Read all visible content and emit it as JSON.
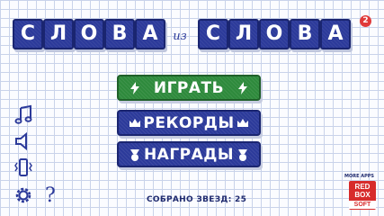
{
  "title": {
    "left_word": [
      "С",
      "Л",
      "О",
      "В",
      "А"
    ],
    "connector": "из",
    "right_word": [
      "С",
      "Л",
      "О",
      "В",
      "А"
    ],
    "version_badge": "2"
  },
  "menu": {
    "play_label": "ИГРАТЬ",
    "records_label": "РЕКОРДЫ",
    "awards_label": "НАГРАДЫ"
  },
  "footer": {
    "stars_label": "СОБРАНО ЗВЕЗД: 25",
    "more_apps": "MORE APPS",
    "logo_line1": "RED",
    "logo_line2": "BOX",
    "logo_line3": "SOFT"
  },
  "icons": {
    "music": "music-note-icon",
    "sound": "speaker-icon",
    "vibration": "vibration-icon",
    "settings": "gear-icon",
    "help": "question-mark-icon"
  },
  "colors": {
    "tile_blue": "#2c3a9a",
    "play_green": "#2e8a3c",
    "badge_red": "#e03a3a",
    "brand_red": "#d72b2b"
  }
}
